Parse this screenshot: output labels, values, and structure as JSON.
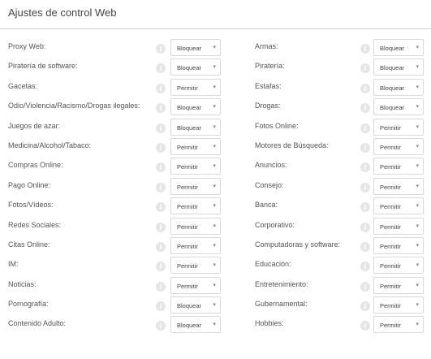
{
  "panel": {
    "title": "Ajustes de control Web"
  },
  "icons": {
    "info": "info-icon",
    "caret": "chevron-down-icon"
  },
  "rows": [
    {
      "left": {
        "label": "Proxy Web:",
        "value": "Bloquear"
      },
      "right": {
        "label": "Armas:",
        "value": "Bloquear"
      }
    },
    {
      "left": {
        "label": "Piratería de software:",
        "value": "Bloquear"
      },
      "right": {
        "label": "Piratería:",
        "value": "Bloquear"
      }
    },
    {
      "left": {
        "label": "Gacetas:",
        "value": "Permitir"
      },
      "right": {
        "label": "Estafas:",
        "value": "Bloquear"
      }
    },
    {
      "left": {
        "label": "Odio/Violencia/Racismo/Drogas ilegales:",
        "value": "Bloquear"
      },
      "right": {
        "label": "Drogas:",
        "value": "Bloquear"
      }
    },
    {
      "left": {
        "label": "Juegos de azar:",
        "value": "Bloquear"
      },
      "right": {
        "label": "Fotos Online:",
        "value": "Permitir"
      }
    },
    {
      "left": {
        "label": "Medicina/Alcohol/Tabaco:",
        "value": "Permitir"
      },
      "right": {
        "label": "Motores de Búsqueda:",
        "value": "Permitir"
      }
    },
    {
      "left": {
        "label": "Compras Online:",
        "value": "Permitir"
      },
      "right": {
        "label": "Anuncios:",
        "value": "Permitir"
      }
    },
    {
      "left": {
        "label": "Pago Online:",
        "value": "Permitir"
      },
      "right": {
        "label": "Consejo:",
        "value": "Permitir"
      }
    },
    {
      "left": {
        "label": "Fotos/Vídeos:",
        "value": "Permitir"
      },
      "right": {
        "label": "Banca:",
        "value": "Permitir"
      }
    },
    {
      "left": {
        "label": "Redes Sociales:",
        "value": "Permitir"
      },
      "right": {
        "label": "Corporativo:",
        "value": "Permitir"
      }
    },
    {
      "left": {
        "label": "Citas Online:",
        "value": "Permitir"
      },
      "right": {
        "label": "Computadoras y software:",
        "value": "Permitir"
      }
    },
    {
      "left": {
        "label": "IM:",
        "value": "Permitir"
      },
      "right": {
        "label": "Educación:",
        "value": "Permitir"
      }
    },
    {
      "left": {
        "label": "Noticias:",
        "value": "Permitir"
      },
      "right": {
        "label": "Entretenimiento:",
        "value": "Permitir"
      }
    },
    {
      "left": {
        "label": "Pornografía:",
        "value": "Bloquear"
      },
      "right": {
        "label": "Gubernamental:",
        "value": "Permitir"
      }
    },
    {
      "left": {
        "label": "Contenido Adulto:",
        "value": "Bloquear"
      },
      "right": {
        "label": "Hobbies:",
        "value": "Permitir"
      }
    }
  ]
}
